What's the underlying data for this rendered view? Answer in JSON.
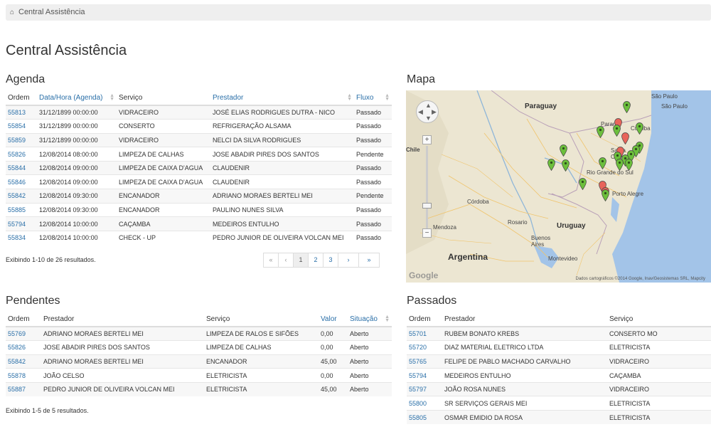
{
  "breadcrumb": {
    "label": "Central Assistência"
  },
  "page_title": "Central Assistência",
  "agenda": {
    "title": "Agenda",
    "columns": [
      "Ordem",
      "Data/Hora (Agenda)",
      "Serviço",
      "Prestador",
      "Fluxo"
    ],
    "rows": [
      [
        "55813",
        "31/12/1899 00:00:00",
        "VIDRACEIRO",
        "JOSÉ ELIAS RODRIGUES DUTRA - NICO",
        "Passado"
      ],
      [
        "55854",
        "31/12/1899 00:00:00",
        "CONSERTO",
        "REFRIGERAÇÃO ALSAMA",
        "Passado"
      ],
      [
        "55859",
        "31/12/1899 00:00:00",
        "VIDRACEIRO",
        "NELCI DA SILVA RODRIGUES",
        "Passado"
      ],
      [
        "55826",
        "12/08/2014 08:00:00",
        "LIMPEZA DE CALHAS",
        "JOSE ABADIR PIRES DOS SANTOS",
        "Pendente"
      ],
      [
        "55844",
        "12/08/2014 09:00:00",
        "LIMPEZA DE CAIXA D'AGUA",
        "CLAUDENIR",
        "Passado"
      ],
      [
        "55846",
        "12/08/2014 09:00:00",
        "LIMPEZA DE CAIXA D'AGUA",
        "CLAUDENIR",
        "Passado"
      ],
      [
        "55842",
        "12/08/2014 09:30:00",
        "ENCANADOR",
        "ADRIANO MORAES BERTELI MEI",
        "Pendente"
      ],
      [
        "55885",
        "12/08/2014 09:30:00",
        "ENCANADOR",
        "PAULINO NUNES SILVA",
        "Passado"
      ],
      [
        "55794",
        "12/08/2014 10:00:00",
        "CAÇAMBA",
        "MEDEIROS ENTULHO",
        "Passado"
      ],
      [
        "55834",
        "12/08/2014 10:00:00",
        "CHECK - UP",
        "PEDRO JUNIOR DE OLIVEIRA VOLCAN MEI",
        "Passado"
      ]
    ],
    "summary": "Exibindo 1-10 de 26 resultados.",
    "pager": {
      "first": "«",
      "prev": "‹",
      "pages": [
        "1",
        "2",
        "3"
      ],
      "next": "›",
      "last": "»"
    }
  },
  "mapa": {
    "title": "Mapa",
    "labels": {
      "paraguay": "Paraguay",
      "parana": "Paraná",
      "sao_paulo": "São Paulo",
      "sao_paulo_city": "São Paulo",
      "curitiba": "Curitiba",
      "santa_catarina": "Santa Catarina",
      "chile": "Chile",
      "rio_grande": "Rio Grande do Sul",
      "porto_alegre": "Porto Alegre",
      "cordoba": "Córdoba",
      "rosario": "Rosario",
      "uruguay": "Uruguay",
      "mendoza": "Mendoza",
      "buenos_aires": "Buenos Aires",
      "montevideo": "Montevideo",
      "argentina": "Argentina"
    },
    "attribution": "Dados cartográficos ©2014 Google, Inav/Geosistemas SRL, Mapcity",
    "logo": "Google",
    "colors": {
      "water": "#a3c4e8",
      "land": "#ece6d2",
      "pin_green": "#6cbf3c",
      "pin_red": "#e8645a"
    }
  },
  "pendentes": {
    "title": "Pendentes",
    "columns": [
      "Ordem",
      "Prestador",
      "Serviço",
      "Valor",
      "Situação"
    ],
    "rows": [
      [
        "55769",
        "ADRIANO MORAES BERTELI MEI",
        "LIMPEZA DE RALOS E SIFÕES",
        "0,00",
        "Aberto"
      ],
      [
        "55826",
        "JOSE ABADIR PIRES DOS SANTOS",
        "LIMPEZA DE CALHAS",
        "0,00",
        "Aberto"
      ],
      [
        "55842",
        "ADRIANO MORAES BERTELI MEI",
        "ENCANADOR",
        "45,00",
        "Aberto"
      ],
      [
        "55878",
        "JOÃO CELSO",
        "ELETRICISTA",
        "0,00",
        "Aberto"
      ],
      [
        "55887",
        "PEDRO JUNIOR DE OLIVEIRA VOLCAN MEI",
        "ELETRICISTA",
        "45,00",
        "Aberto"
      ]
    ],
    "summary": "Exibindo 1-5 de 5 resultados."
  },
  "passados": {
    "title": "Passados",
    "columns": [
      "Ordem",
      "Prestador",
      "Serviço"
    ],
    "rows": [
      [
        "55701",
        "RUBEM BONATO KREBS",
        "CONSERTO MO"
      ],
      [
        "55720",
        "DIAZ MATERIAL ELETRICO LTDA",
        "ELETRICISTA"
      ],
      [
        "55765",
        "FELIPE DE PABLO MACHADO CARVALHO",
        "VIDRACEIRO"
      ],
      [
        "55794",
        "MEDEIROS ENTULHO",
        "CAÇAMBA"
      ],
      [
        "55797",
        "JOÃO ROSA NUNES",
        "VIDRACEIRO"
      ],
      [
        "55800",
        "SR SERVIÇOS GERAIS MEI",
        "ELETRICISTA"
      ],
      [
        "55805",
        "OSMAR EMIDIO DA ROSA",
        "ELETRICISTA"
      ]
    ]
  }
}
